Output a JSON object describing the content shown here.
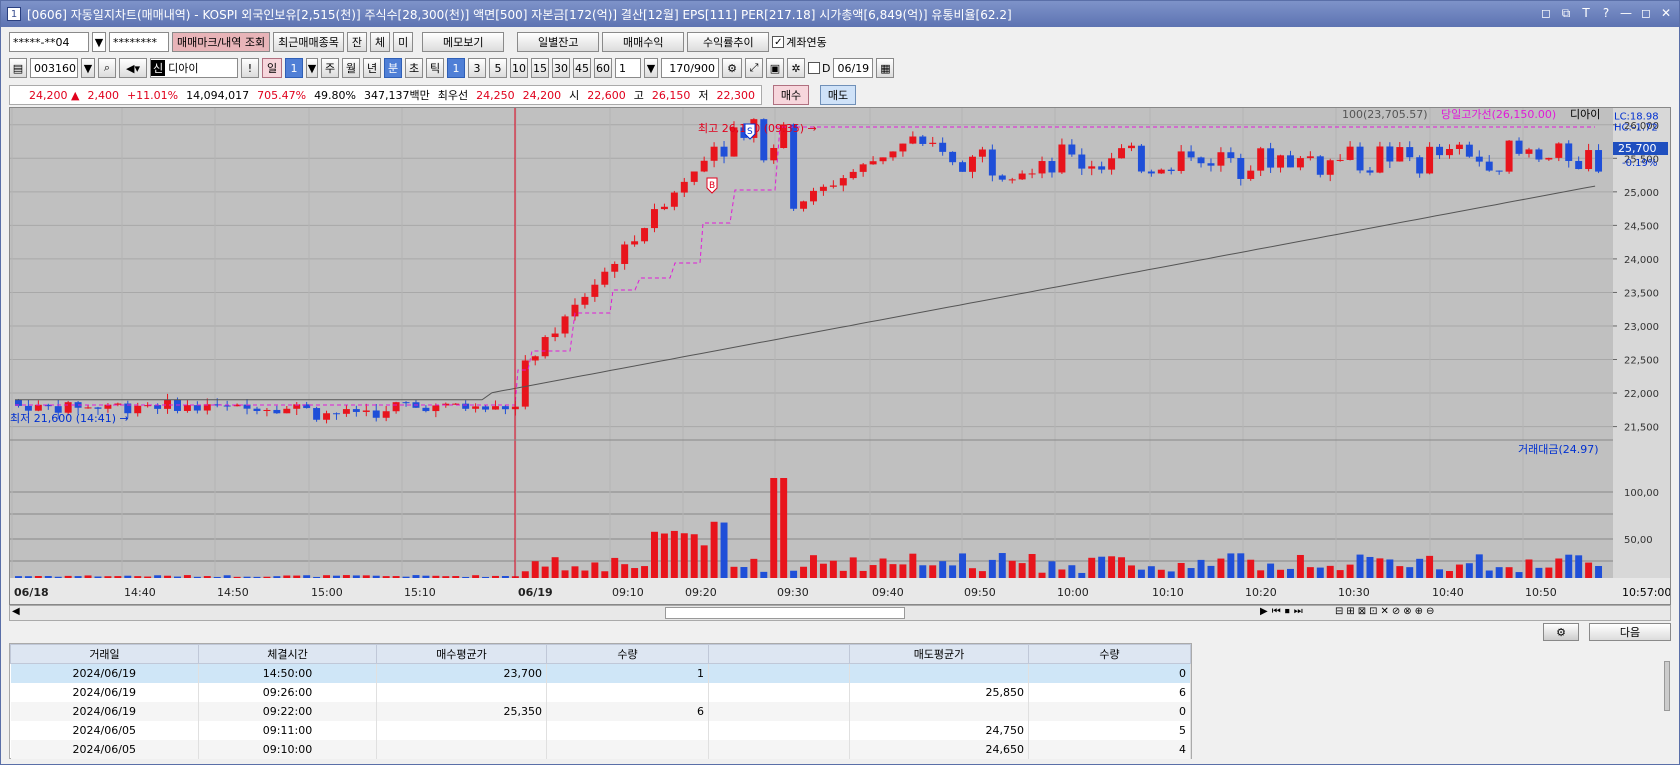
{
  "title": "[0606] 자동일지차트(매매내역) - KOSPI 외국인보유[2,515(천)] 주식수[28,300(천)] 액면[500] 자본금[172(억)] 결산[12월] EPS[111] PER[217.18] 시가총액[6,849(억)] 유통비율[62.2]",
  "title_num": "1",
  "title_buttons": [
    "◻",
    "⧉",
    "T",
    "?",
    "—",
    "◻",
    "✕"
  ],
  "toolbar1": {
    "account": "*****-**04",
    "password": "********",
    "btn_marks": "매매마크/내역 조회",
    "btn_recent": "최근매매종목",
    "btn_jan": "잔",
    "btn_che": "체",
    "btn_mi": "미",
    "btn_memo": "메모보기",
    "btn_daily": "일별잔고",
    "btn_profit": "매매수익",
    "btn_trend": "수익률추이",
    "chk_link": "계좌연동"
  },
  "toolbar2": {
    "code": "003160",
    "name": "디아이",
    "sin": "신",
    "excl": "!",
    "period_day": "일",
    "period_num": "1",
    "week": "주",
    "month": "월",
    "year": "년",
    "minute": "분",
    "second": "초",
    "tick": "틱",
    "intervals": [
      "1",
      "3",
      "5",
      "10",
      "15",
      "30",
      "45",
      "60"
    ],
    "count": "1",
    "range": "170/900",
    "d_label": "D",
    "date": "06/19"
  },
  "quote": {
    "price": "24,200 ▲",
    "change": "2,400",
    "pct": "+11.01%",
    "volume": "14,094,017",
    "vol_pct": "705.47%",
    "rate": "49.80%",
    "amount": "347,137백만",
    "prior_label": "최우선",
    "ask": "24,250",
    "bid": "24,200",
    "open_label": "시",
    "open": "22,600",
    "high_label": "고",
    "high": "26,150",
    "low_label": "저",
    "low": "22,300",
    "buy_btn": "매수",
    "sell_btn": "매도"
  },
  "chart_labels": {
    "ma": "100(23,705.57)",
    "high_line": "당일고가선(26,150.00)",
    "name": "디아이",
    "lc": "LC:18.98",
    "hc": "HC:-1.72",
    "cur_price": "25,700",
    "cur_pct": "-0.19%",
    "max_note": "최고 26,150 (09:35) →",
    "min_note": "최저 21,600 (14:41) →",
    "vol_title": "거래대금(24.97)",
    "end_time": "10:57:00",
    "mark_s": "S",
    "mark_b": "B"
  },
  "chart_data": {
    "type": "candlestick",
    "y_ticks": [
      "26,000",
      "25,500",
      "25,000",
      "24,500",
      "24,000",
      "23,500",
      "23,000",
      "22,500",
      "22,000",
      "21,500"
    ],
    "ylim": [
      21300,
      26250
    ],
    "vol_ticks": [
      "100,00",
      "50,00"
    ],
    "x_ticks": [
      "06/18",
      "14:40",
      "14:50",
      "15:00",
      "15:10",
      "06/19",
      "09:10",
      "09:20",
      "09:30",
      "09:40",
      "09:50",
      "10:00",
      "10:10",
      "10:20",
      "10:30",
      "10:40",
      "10:50"
    ]
  },
  "table": {
    "headers": [
      "거래일",
      "체결시간",
      "매수평균가",
      "수량",
      "",
      "매도평균가",
      "수량"
    ],
    "rows": [
      [
        "2024/06/19",
        "14:50:00",
        "23,700",
        "1",
        "",
        "",
        "0"
      ],
      [
        "2024/06/19",
        "09:26:00",
        "",
        "",
        "",
        "25,850",
        "6"
      ],
      [
        "2024/06/19",
        "09:22:00",
        "25,350",
        "6",
        "",
        "",
        "0"
      ],
      [
        "2024/06/05",
        "09:11:00",
        "",
        "",
        "",
        "24,750",
        "5"
      ],
      [
        "2024/06/05",
        "09:10:00",
        "",
        "",
        "",
        "24,650",
        "4"
      ]
    ],
    "next_btn": "다음"
  }
}
